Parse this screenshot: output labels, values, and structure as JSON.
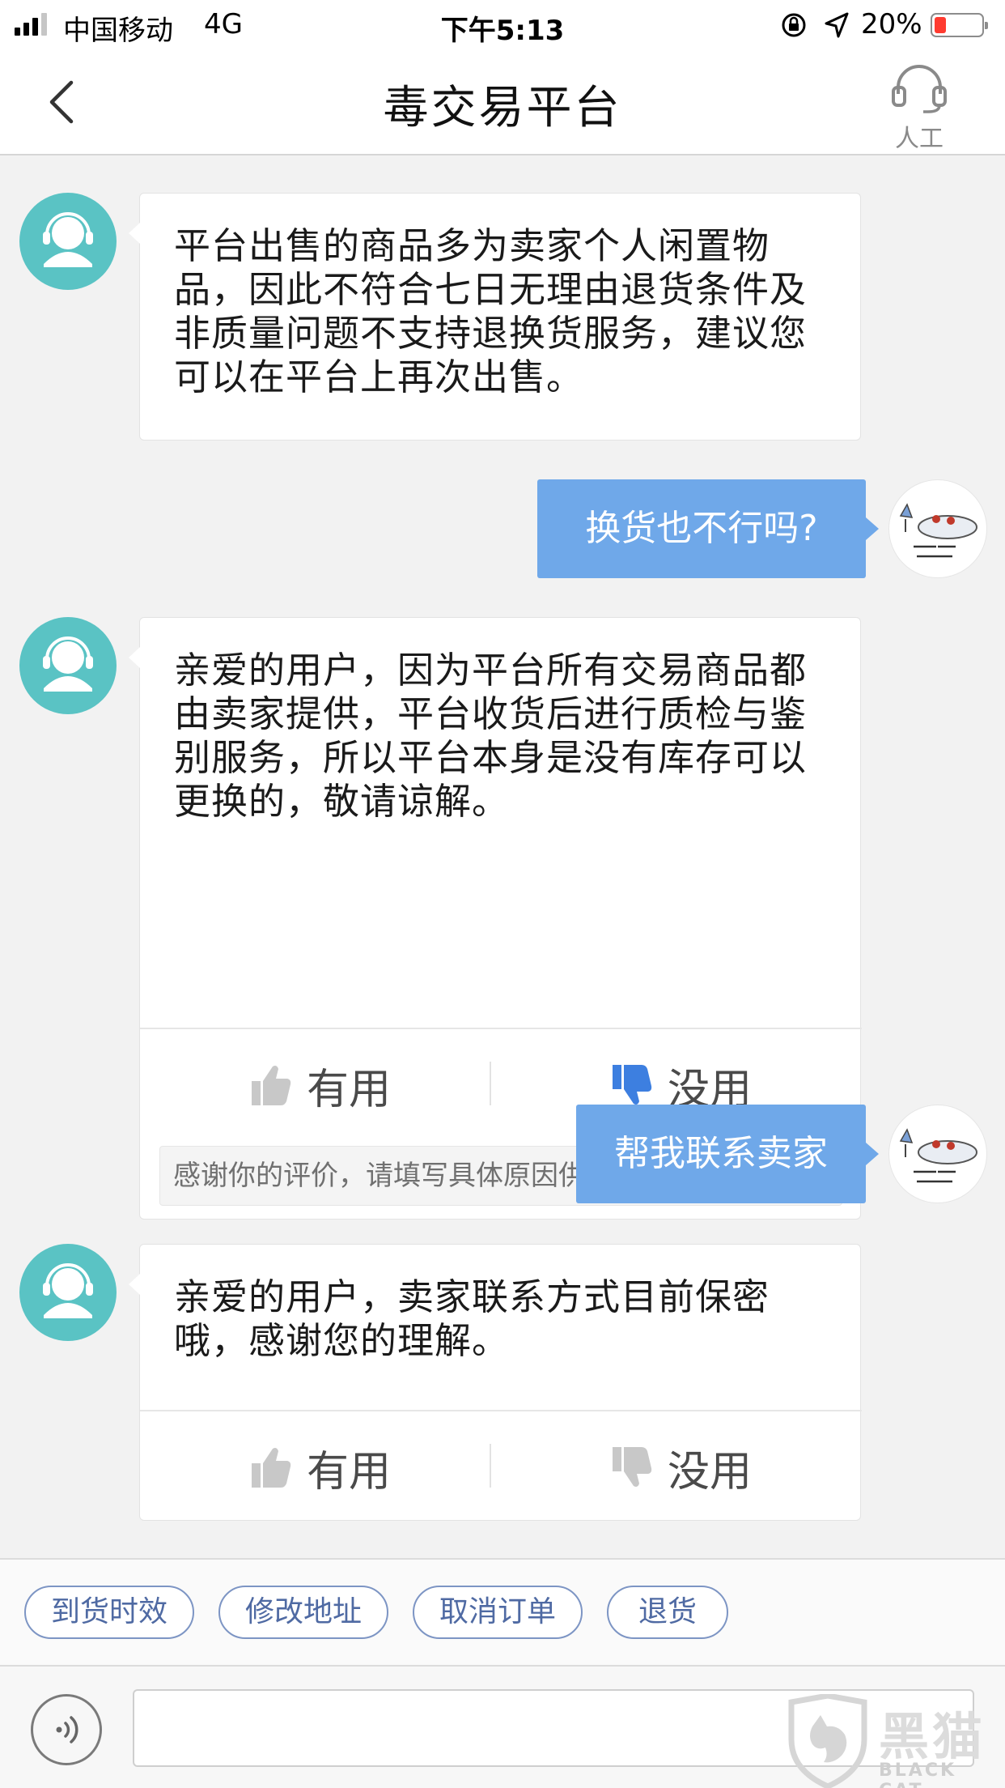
{
  "status_bar": {
    "carrier": "中国移动",
    "network": "4G",
    "time": "下午5:13",
    "battery_percent": "20%",
    "battery_level": 0.2
  },
  "nav": {
    "title": "毒交易平台",
    "agent_label": "人工"
  },
  "messages": [
    {
      "from": "agent",
      "text": "平台出售的商品多为卖家个人闲置物品，因此不符合七日无理由退货条件及非质量问题不支持退换货服务，建议您可以在平台上再次出售。"
    },
    {
      "from": "user",
      "text": "换货也不行吗?"
    },
    {
      "from": "agent",
      "text": "亲爱的用户，因为平台所有交易商品都由卖家提供，平台收货后进行质检与鉴别服务，所以平台本身是没有库存可以更换的，敬请谅解。",
      "useful_label": "有用",
      "useless_label": "没用",
      "feedback_note": "感谢你的评价，请填写具体原因供我们改进",
      "selected": "useless"
    },
    {
      "from": "user",
      "text": "帮我联系卖家"
    },
    {
      "from": "agent",
      "text": "亲爱的用户，卖家联系方式目前保密哦，感谢您的理解。",
      "useful_label": "有用",
      "useless_label": "没用"
    }
  ],
  "quick_replies": [
    "到货时效",
    "修改地址",
    "取消订单",
    "退货"
  ],
  "input": {
    "placeholder": "",
    "value": ""
  },
  "watermark": {
    "cn": "黑猫",
    "en": "BLACK CAT"
  },
  "colors": {
    "user_bubble": "#6fa8e9",
    "agent_avatar": "#5ac3c4",
    "thumb_selected": "#3d7fe0",
    "thumb_inactive": "#c8c8c8",
    "chip_border": "#7d95c4"
  },
  "icons": {
    "back": "chevron-left-icon",
    "agent": "headset-icon",
    "voice": "voice-icon",
    "useful": "thumbs-up-icon",
    "useless": "thumbs-down-icon"
  }
}
